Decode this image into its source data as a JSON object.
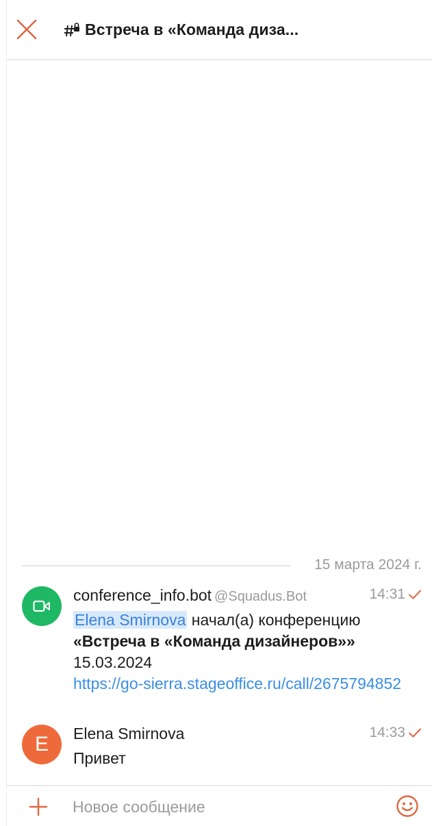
{
  "header": {
    "title": "Встреча в «Команда диза...",
    "close_icon": "close-icon",
    "channel_icon": "channel-hash-lock-icon"
  },
  "colors": {
    "accent": "#e0673f",
    "bot_avatar": "#1fb864",
    "user_avatar": "#ef6a3a",
    "link": "#3a8ee6",
    "mention_bg": "#d8e9fb"
  },
  "date_separator": "15 марта 2024 г.",
  "messages": [
    {
      "sender": "conference_info.bot",
      "handle": "@Squadus.Bot",
      "time": "14:31",
      "avatar_icon": "video-camera-icon",
      "mention": "Elena Smirnova",
      "text_after_mention": " начал(а) конференцию",
      "conference_name": "«Встреча в «Команда дизайнеров»»",
      "date": "15.03.2024",
      "link": "https://go-sierra.stageoffice.ru/call/2675794852",
      "status_icon": "sent-check-icon"
    },
    {
      "sender": "Elena Smirnova",
      "time": "14:33",
      "avatar_letter": "E",
      "text": "Привет",
      "status_icon": "sent-check-icon"
    }
  ],
  "composer": {
    "placeholder": "Новое сообщение",
    "attach_icon": "plus-icon",
    "emoji_icon": "emoji-icon"
  }
}
